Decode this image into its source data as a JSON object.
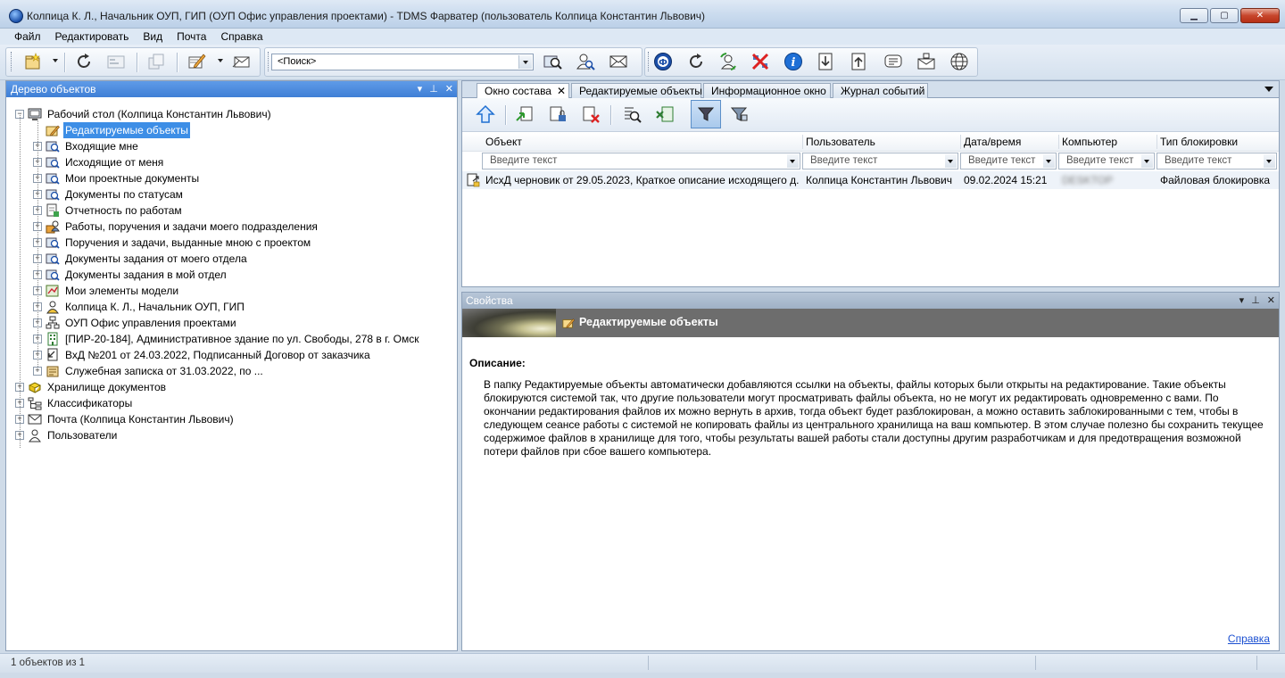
{
  "window": {
    "title": "Колпица К. Л., Начальник ОУП, ГИП (ОУП Офис управления проектами) - TDMS Фарватер (пользователь Колпица Константин Львович)"
  },
  "menu": [
    "Файл",
    "Редактировать",
    "Вид",
    "Почта",
    "Справка"
  ],
  "search": {
    "value": "<Поиск>"
  },
  "left_pane": {
    "title": "Дерево объектов",
    "tree": [
      {
        "label": "Рабочий стол (Колпица Константин Львович)",
        "level": 0,
        "expander": "−",
        "icon": "desktop-icon"
      },
      {
        "label": "Редактируемые объекты",
        "level": 1,
        "expander": "",
        "icon": "edit-folder-icon",
        "selected": true
      },
      {
        "label": "Входящие мне",
        "level": 1,
        "expander": "+",
        "icon": "search-folder-icon"
      },
      {
        "label": "Исходящие от меня",
        "level": 1,
        "expander": "+",
        "icon": "search-folder-icon"
      },
      {
        "label": "Мои проектные документы",
        "level": 1,
        "expander": "+",
        "icon": "search-folder-icon"
      },
      {
        "label": "Документы по статусам",
        "level": 1,
        "expander": "+",
        "icon": "search-folder-icon"
      },
      {
        "label": "Отчетность по работам",
        "level": 1,
        "expander": "+",
        "icon": "report-icon"
      },
      {
        "label": "Работы, поручения и задачи моего подразделения",
        "level": 1,
        "expander": "+",
        "icon": "tasks-icon"
      },
      {
        "label": "Поручения и задачи, выданные мною с проектом",
        "level": 1,
        "expander": "+",
        "icon": "search-folder-icon"
      },
      {
        "label": "Документы задания от моего отдела",
        "level": 1,
        "expander": "+",
        "icon": "search-folder-icon"
      },
      {
        "label": "Документы задания в мой отдел",
        "level": 1,
        "expander": "+",
        "icon": "search-folder-icon"
      },
      {
        "label": "Мои элементы модели",
        "level": 1,
        "expander": "+",
        "icon": "model-icon"
      },
      {
        "label": "Колпица К. Л., Начальник ОУП, ГИП",
        "level": 1,
        "expander": "+",
        "icon": "user-icon"
      },
      {
        "label": "ОУП Офис управления проектами",
        "level": 1,
        "expander": "+",
        "icon": "org-icon"
      },
      {
        "label": "[ПИР-20-184], Административное здание по ул. Свободы, 278 в г. Омск",
        "level": 1,
        "expander": "+",
        "icon": "building-icon"
      },
      {
        "label": "ВхД №201 от 24.03.2022, Подписанный Договор от заказчика",
        "level": 1,
        "expander": "+",
        "icon": "incoming-doc-icon"
      },
      {
        "label": "Служебная записка от 31.03.2022, по ...",
        "level": 1,
        "expander": "+",
        "icon": "memo-icon"
      },
      {
        "label": "Хранилище документов",
        "level": 0,
        "expander": "+",
        "icon": "storage-icon"
      },
      {
        "label": "Классификаторы",
        "level": 0,
        "expander": "+",
        "icon": "classifier-icon"
      },
      {
        "label": "Почта (Колпица Константин Львович)",
        "level": 0,
        "expander": "+",
        "icon": "mail-icon"
      },
      {
        "label": "Пользователи",
        "level": 0,
        "expander": "+",
        "icon": "users-icon"
      }
    ]
  },
  "tabs": [
    {
      "label": "Окно состава",
      "active": true,
      "closable": true
    },
    {
      "label": "Редактируемые объекты"
    },
    {
      "label": "Информационное окно"
    },
    {
      "label": "Журнал событий"
    }
  ],
  "grid": {
    "columns": [
      "Объект",
      "Пользователь",
      "Дата/время",
      "Компьютер",
      "Тип блокировки"
    ],
    "filter_placeholder": "Введите текст",
    "rows": [
      {
        "object": "ИсхД  черновик от 29.05.2023, Краткое описание исходящего д...",
        "user": "Колпица Константин Львович",
        "datetime": "09.02.2024 15:21",
        "computer": "DESKTOP",
        "lock": "Файловая блокировка"
      }
    ]
  },
  "properties": {
    "title": "Свойства",
    "banner_title": "Редактируемые объекты",
    "description_heading": "Описание:",
    "description": "В папку Редактируемые объекты автоматически добавляются ссылки на объекты, файлы которых были открыты на редактирование. Такие объекты блокируются системой так, что другие пользователи могут просматривать файлы объекта, но не могут их редактировать одновременно с вами. По окончании редактирования файлов их можно вернуть в архив, тогда объект будет разблокирован, а можно оставить заблокированными с тем, чтобы в следующем сеансе работы с системой не копировать файлы из центрального хранилища на ваш компьютер. В этом случае полезно бы сохранить текущее содержимое файлов в хранилище для того, чтобы результаты вашей работы стали доступны другим разработчикам и для предотвращения возможной потери файлов при сбое вашего компьютера.",
    "help_link": "Справка"
  },
  "status": {
    "text": "1 объектов из 1"
  }
}
